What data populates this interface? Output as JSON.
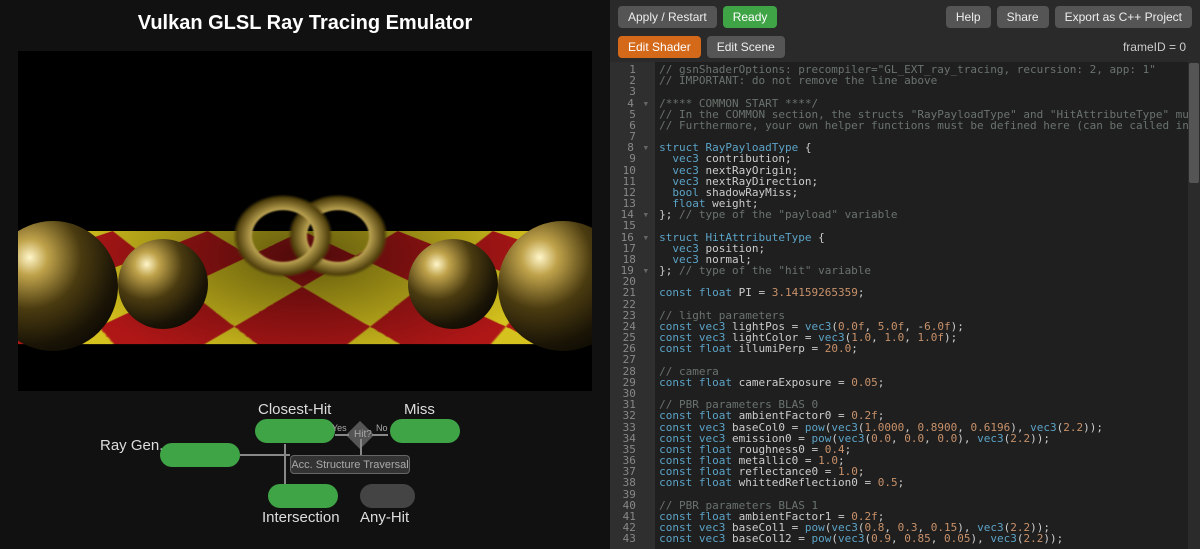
{
  "app": {
    "title": "Vulkan GLSL Ray Tracing Emulator"
  },
  "toolbar": {
    "apply": "Apply / Restart",
    "ready": "Ready",
    "help": "Help",
    "share": "Share",
    "export": "Export as C++ Project",
    "frame_id_label": "frameID = 0"
  },
  "tabs": {
    "edit_shader": "Edit Shader",
    "edit_scene": "Edit Scene"
  },
  "diagram": {
    "ray_gen": "Ray Gen.",
    "closest_hit": "Closest-Hit",
    "miss": "Miss",
    "intersection": "Intersection",
    "any_hit": "Any-Hit",
    "traversal": "Acc. Structure Traversal",
    "hit": "Hit?",
    "yes": "Yes",
    "no": "No"
  },
  "code": {
    "lines": [
      "// gsnShaderOptions: precompiler=\"GL_EXT_ray_tracing, recursion: 2, app: 1\"",
      "// IMPORTANT: do not remove the line above",
      "",
      "/**** COMMON START ****/",
      "// In the COMMON section, the structs \"RayPayloadType\" and \"HitAttributeType\" must be defined.",
      "// Furthermore, your own helper functions must be defined here (can be called in all shaders).",
      "",
      "struct RayPayloadType {",
      "  vec3 contribution;",
      "  vec3 nextRayOrigin;",
      "  vec3 nextRayDirection;",
      "  bool shadowRayMiss;",
      "  float weight;",
      "}; // type of the \"payload\" variable",
      "",
      "struct HitAttributeType {",
      "  vec3 position;",
      "  vec3 normal;",
      "}; // type of the \"hit\" variable",
      "",
      "const float PI = 3.14159265359;",
      "",
      "// light parameters",
      "const vec3 lightPos = vec3(0.0f, 5.0f, -6.0f);",
      "const vec3 lightColor = vec3(1.0, 1.0, 1.0f);",
      "const float illumiPerp = 20.0;",
      "",
      "// camera",
      "const float cameraExposure = 0.05;",
      "",
      "// PBR parameters BLAS 0",
      "const float ambientFactor0 = 0.2f;",
      "const vec3 baseCol0 = pow(vec3(1.0000, 0.8900, 0.6196), vec3(2.2));",
      "const vec3 emission0 = pow(vec3(0.0, 0.0, 0.0), vec3(2.2));",
      "const float roughness0 = 0.4;",
      "const float metallic0 = 1.0;",
      "const float reflectance0 = 1.0;",
      "const float whittedReflection0 = 0.5;",
      "",
      "// PBR parameters BLAS 1",
      "const float ambientFactor1 = 0.2f;",
      "const vec3 baseCol1 = pow(vec3(0.8, 0.3, 0.15), vec3(2.2));",
      "const vec3 baseCol12 = pow(vec3(0.9, 0.85, 0.05), vec3(2.2));"
    ],
    "line_numbers": [
      1,
      2,
      3,
      4,
      5,
      6,
      7,
      8,
      9,
      10,
      11,
      12,
      13,
      14,
      15,
      16,
      17,
      18,
      19,
      20,
      21,
      22,
      23,
      24,
      25,
      26,
      27,
      28,
      29,
      30,
      31,
      32,
      33,
      34,
      35,
      36,
      37,
      38,
      39,
      40,
      41,
      42,
      43
    ],
    "fold_lines": [
      4,
      8,
      14,
      16,
      19
    ]
  }
}
